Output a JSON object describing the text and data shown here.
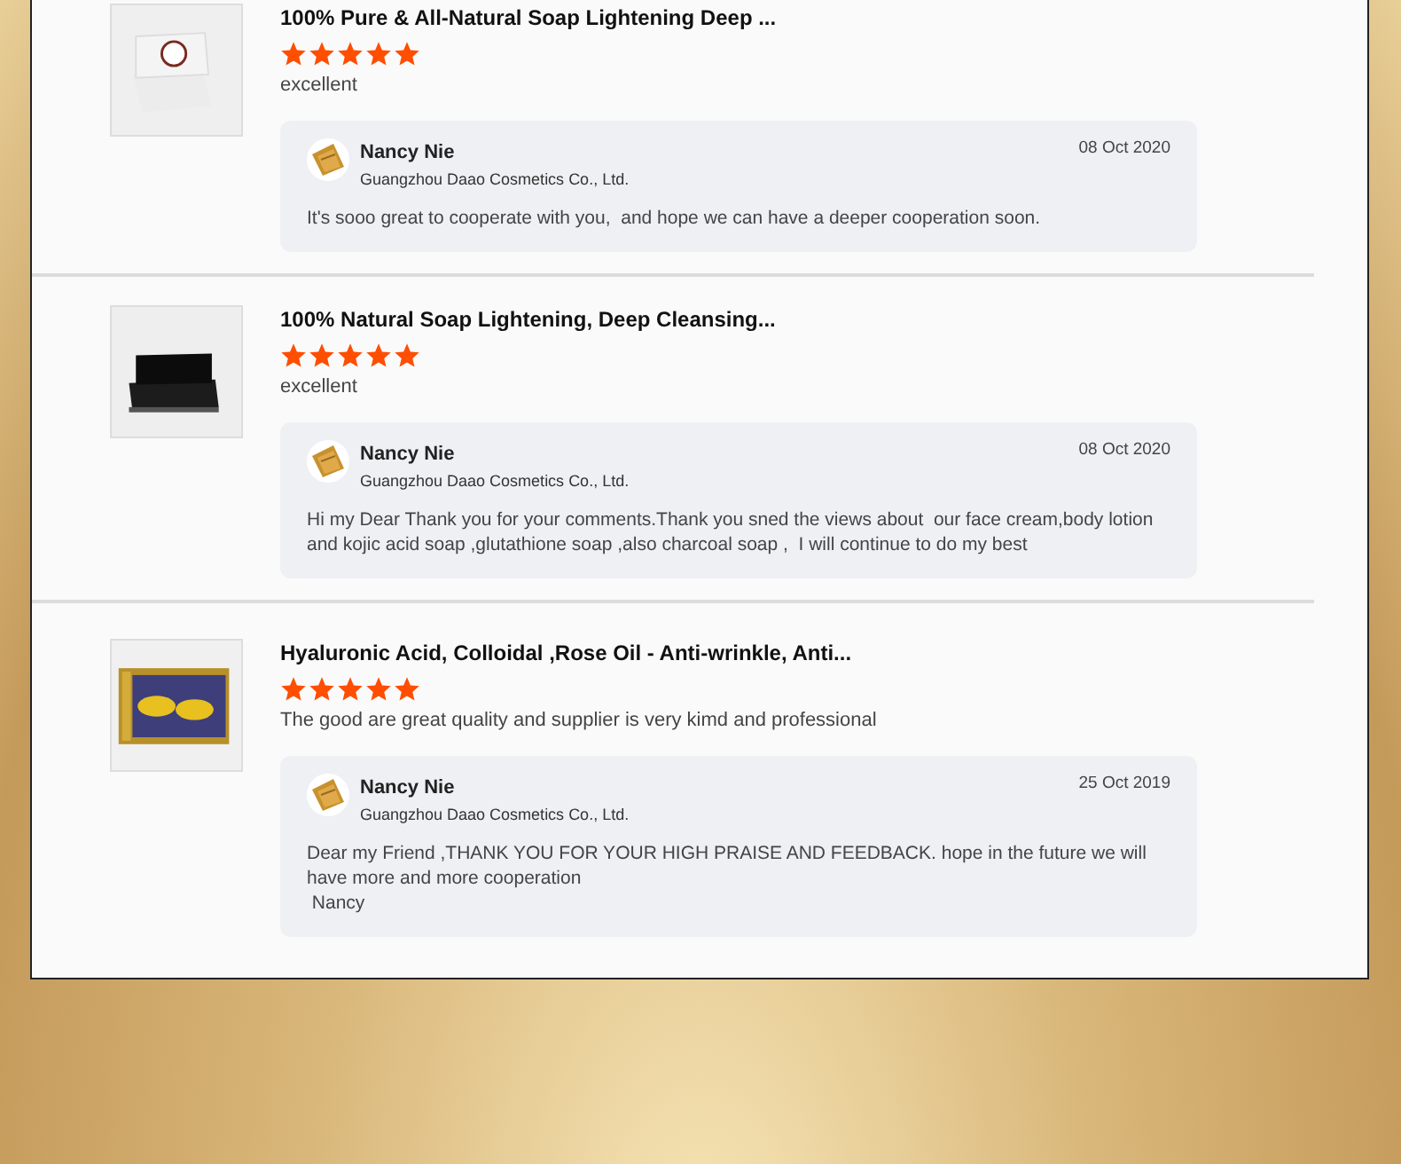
{
  "reviews": [
    {
      "product_title": "100% Pure & All-Natural Soap Lightening Deep ...",
      "stars": 5,
      "comment": "excellent",
      "reply": {
        "name": "Nancy Nie",
        "company": "Guangzhou Daao Cosmetics Co., Ltd.",
        "date": "08 Oct 2020",
        "text": "It's sooo great to cooperate with you,  and hope we can have a deeper cooperation soon."
      }
    },
    {
      "product_title": "100% Natural Soap Lightening, Deep Cleansing...",
      "stars": 5,
      "comment": "excellent",
      "reply": {
        "name": "Nancy Nie",
        "company": "Guangzhou Daao Cosmetics Co., Ltd.",
        "date": "08 Oct 2020",
        "text": "Hi my Dear Thank you for your comments.Thank you sned the views about  our face cream,body lotion and kojic acid soap ,glutathione soap ,also charcoal soap ,  I will continue to do my best"
      }
    },
    {
      "product_title": "Hyaluronic Acid, Colloidal ,Rose Oil - Anti-wrinkle, Anti...",
      "stars": 5,
      "comment": "The good are great quality and supplier is very kimd and professional",
      "reply": {
        "name": "Nancy Nie",
        "company": "Guangzhou Daao Cosmetics Co., Ltd.",
        "date": "25 Oct 2019",
        "text": "Dear my Friend ,THANK YOU FOR YOUR HIGH PRAISE AND FEEDBACK. hope in the future we will have more and more cooperation\n Nancy"
      }
    }
  ]
}
